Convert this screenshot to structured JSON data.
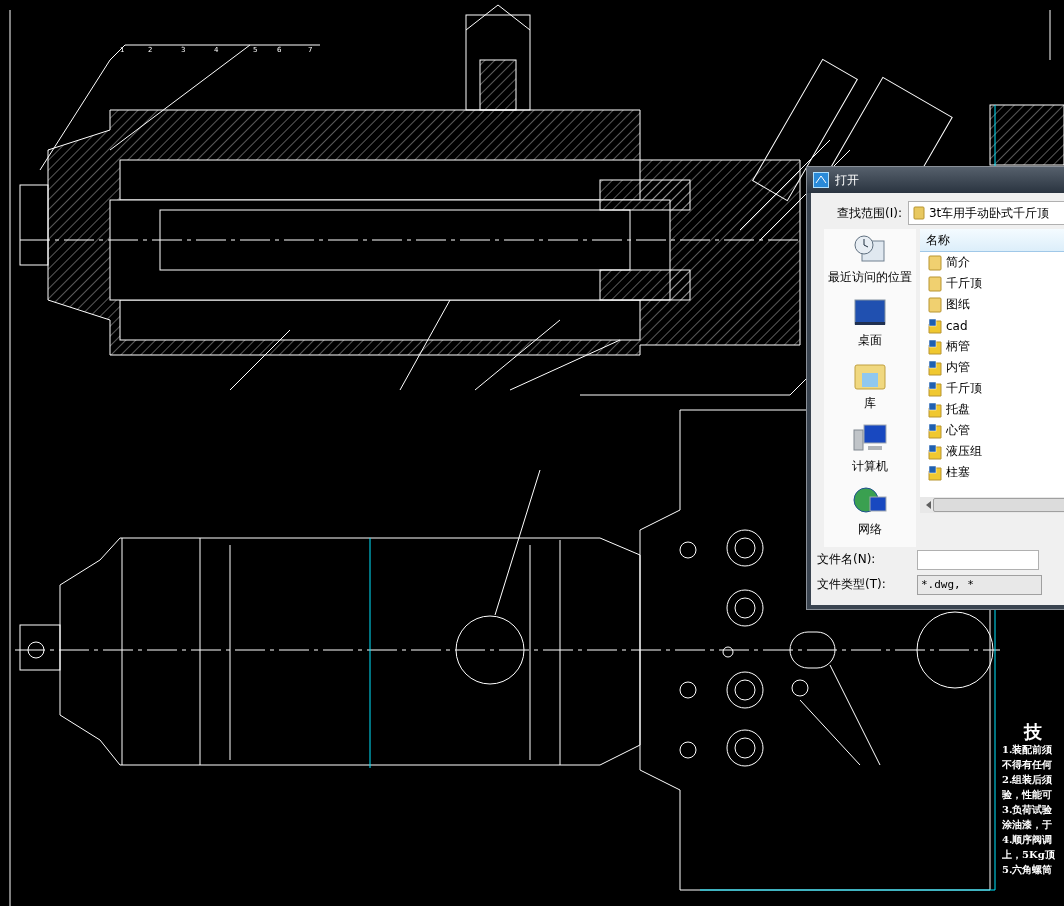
{
  "drawing": {
    "part_labels": [
      "1",
      "2",
      "3",
      "4",
      "5",
      "6",
      "7"
    ],
    "notes_title": "技",
    "notes": [
      "1.装配前须",
      "不得有任何",
      "2.组装后须",
      "验，性能可",
      "3.负荷试验",
      "涂油漆，于",
      "4.顺序阀调",
      "上，5Kg顶",
      "5.六角螺筒"
    ]
  },
  "dialog": {
    "title": "打开",
    "look_in_label": "查找范围(I):",
    "look_in_value": "3t车用手动卧式千斤顶",
    "places": [
      {
        "label": "最近访问的位置",
        "kind": "recent"
      },
      {
        "label": "桌面",
        "kind": "desktop"
      },
      {
        "label": "库",
        "kind": "library"
      },
      {
        "label": "计算机",
        "kind": "computer"
      },
      {
        "label": "网络",
        "kind": "network"
      }
    ],
    "list_header": "名称",
    "files": [
      {
        "name": "简介",
        "kind": "folder"
      },
      {
        "name": "千斤顶",
        "kind": "folder"
      },
      {
        "name": "图纸",
        "kind": "folder"
      },
      {
        "name": "cad",
        "kind": "shortcut"
      },
      {
        "name": "柄管",
        "kind": "shortcut"
      },
      {
        "name": "内管",
        "kind": "shortcut"
      },
      {
        "name": "千斤顶",
        "kind": "shortcut"
      },
      {
        "name": "托盘",
        "kind": "shortcut"
      },
      {
        "name": "心管",
        "kind": "shortcut"
      },
      {
        "name": "液压组",
        "kind": "shortcut"
      },
      {
        "name": "柱塞",
        "kind": "shortcut"
      }
    ],
    "file_name_label": "文件名(N):",
    "file_type_label": "文件类型(T):",
    "file_type_value": "*.dwg, *"
  }
}
